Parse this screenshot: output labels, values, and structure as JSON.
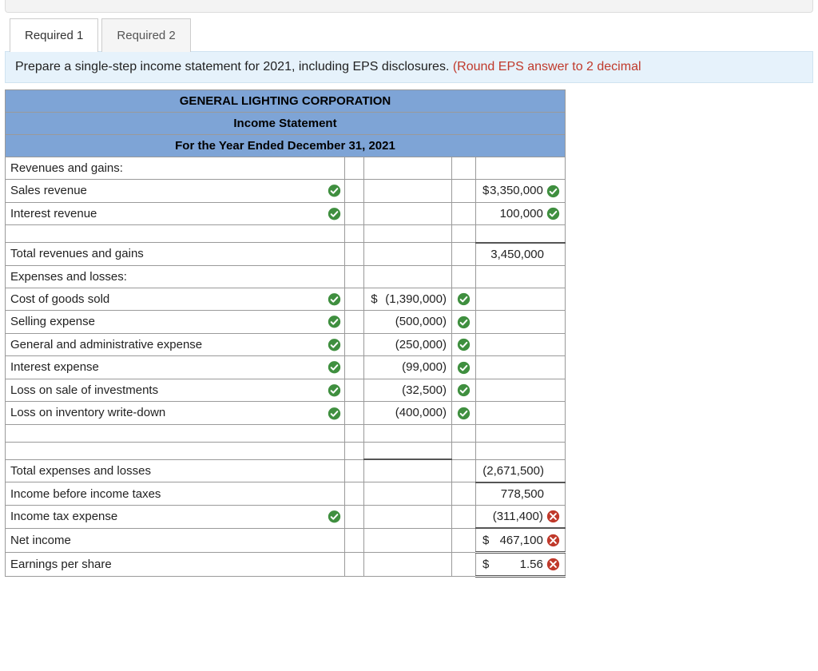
{
  "tabs": {
    "req1": "Required 1",
    "req2": "Required 2"
  },
  "instruction": {
    "text": "Prepare a single-step income statement for 2021, including EPS disclosures. ",
    "note": "(Round EPS answer to 2 decimal"
  },
  "header": {
    "company": "GENERAL LIGHTING CORPORATION",
    "title": "Income Statement",
    "period": "For the Year Ended December 31, 2021"
  },
  "rows": {
    "rev_gains": "Revenues and gains:",
    "sales_rev": {
      "label": "Sales revenue",
      "value": "3,350,000",
      "cur": "$"
    },
    "int_rev": {
      "label": "Interest revenue",
      "value": "100,000"
    },
    "tot_rev": {
      "label": "Total revenues and gains",
      "value": "3,450,000"
    },
    "exp_loss": "Expenses and losses:",
    "cogs": {
      "label": "Cost of goods sold",
      "value": "(1,390,000)",
      "cur": "$"
    },
    "selling": {
      "label": "Selling expense",
      "value": "(500,000)"
    },
    "ga": {
      "label": "General and administrative expense",
      "value": "(250,000)"
    },
    "int_exp": {
      "label": "Interest expense",
      "value": "(99,000)"
    },
    "loss_inv": {
      "label": "Loss on sale of investments",
      "value": "(32,500)"
    },
    "loss_write": {
      "label": "Loss on inventory write-down",
      "value": "(400,000)"
    },
    "tot_exp": {
      "label": "Total expenses and losses",
      "value": "(2,671,500)"
    },
    "ibt": {
      "label": "Income before income taxes",
      "value": "778,500"
    },
    "tax": {
      "label": "Income tax expense",
      "value": "(311,400)"
    },
    "net": {
      "label": "Net income",
      "value": "467,100",
      "cur": "$"
    },
    "eps": {
      "label": "Earnings per share",
      "value": "1.56",
      "cur": "$"
    }
  },
  "icons": {
    "check": "check-icon",
    "cross": "cross-icon"
  }
}
